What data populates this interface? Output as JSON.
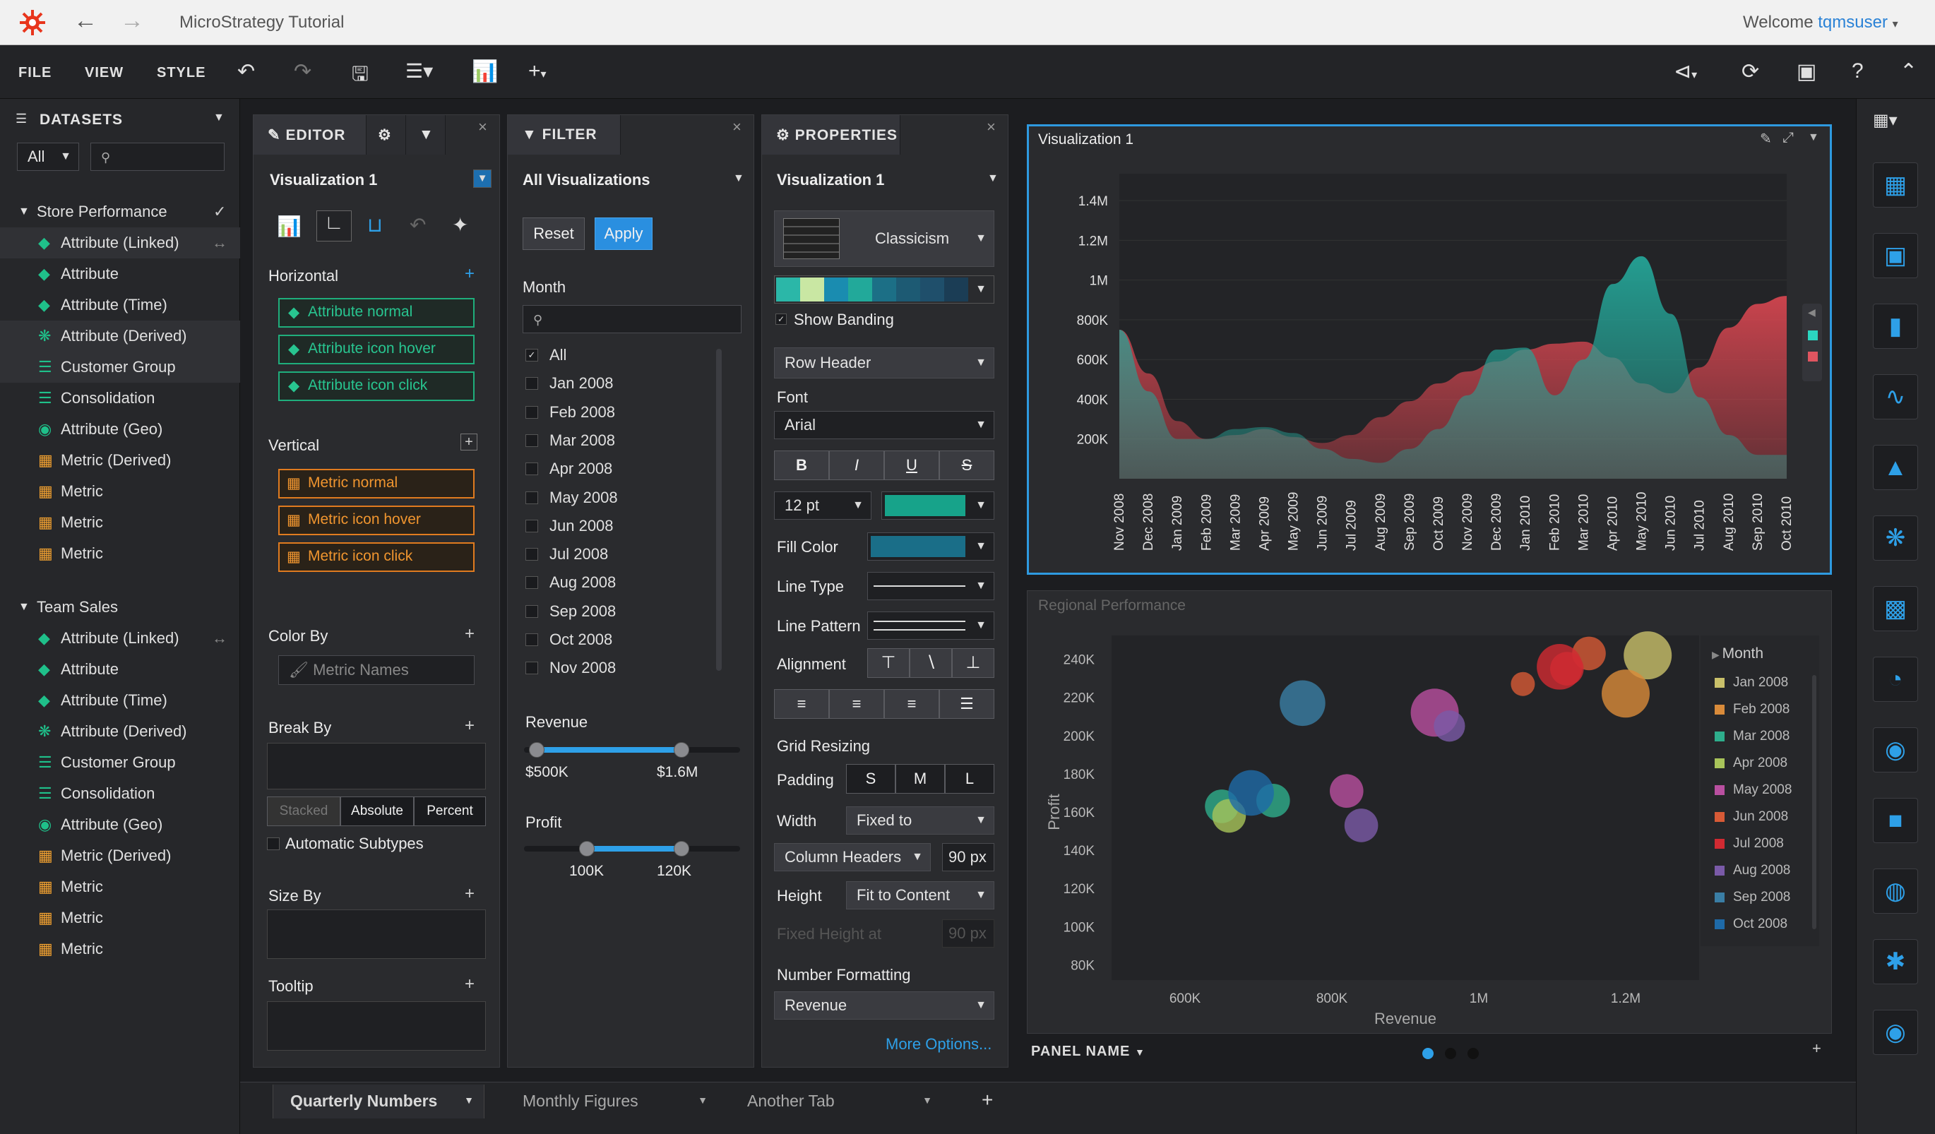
{
  "app": {
    "title": "MicroStrategy Tutorial",
    "welcome": "Welcome ",
    "user": "tqmsuser"
  },
  "menu": {
    "file": "FILE",
    "view": "VIEW",
    "style": "STYLE"
  },
  "datasets": {
    "title": "DATASETS",
    "filter": "All",
    "groups": [
      {
        "name": "Store Performance",
        "items": [
          "Attribute (Linked)",
          "Attribute",
          "Attribute (Time)",
          "Attribute (Derived)",
          "Customer Group",
          "Consolidation",
          "Attribute (Geo)",
          "Metric (Derived)",
          "Metric",
          "Metric",
          "Metric"
        ]
      },
      {
        "name": "Team Sales",
        "items": [
          "Attribute (Linked)",
          "Attribute",
          "Attribute (Time)",
          "Attribute (Derived)",
          "Customer Group",
          "Consolidation",
          "Attribute (Geo)",
          "Metric (Derived)",
          "Metric",
          "Metric",
          "Metric"
        ]
      }
    ]
  },
  "editor": {
    "tab": "EDITOR",
    "viz": "Visualization 1",
    "horizontal": "Horizontal",
    "h_items": [
      "Attribute normal",
      "Attribute icon hover",
      "Attribute icon click"
    ],
    "vertical": "Vertical",
    "v_items": [
      "Metric normal",
      "Metric icon hover",
      "Metric icon click"
    ],
    "color_by": "Color By",
    "color_placeholder": "Metric Names",
    "break_by": "Break By",
    "seg": [
      "Stacked",
      "Absolute",
      "Percent"
    ],
    "auto_subtypes": "Automatic Subtypes",
    "size_by": "Size By",
    "tooltip": "Tooltip"
  },
  "filter": {
    "tab": "FILTER",
    "scope": "All Visualizations",
    "reset": "Reset",
    "apply": "Apply",
    "month": "Month",
    "months": [
      "All",
      "Jan 2008",
      "Feb 2008",
      "Mar 2008",
      "Apr 2008",
      "May 2008",
      "Jun 2008",
      "Jul 2008",
      "Aug 2008",
      "Sep 2008",
      "Oct 2008",
      "Nov 2008"
    ],
    "revenue": "Revenue",
    "rev_min": "$500K",
    "rev_max": "$1.6M",
    "rev_range": [
      0.06,
      0.73
    ],
    "profit": "Profit",
    "prof_min": "100K",
    "prof_max": "120K",
    "prof_range": [
      0.29,
      0.73
    ]
  },
  "properties": {
    "tab": "PROPERTIES",
    "viz": "Visualization 1",
    "theme": "Classicism",
    "show_banding": "Show Banding",
    "row_header": "Row Header",
    "font_label": "Font",
    "font": "Arial",
    "bold": "B",
    "italic": "I",
    "underline": "U",
    "strike": "S",
    "size": "12 pt",
    "fill_color": "Fill Color",
    "line_type": "Line Type",
    "line_pattern": "Line Pattern",
    "alignment": "Alignment",
    "grid_resizing": "Grid Resizing",
    "padding": "Padding",
    "pad_opts": [
      "S",
      "M",
      "L"
    ],
    "width": "Width",
    "width_val": "Fixed to",
    "col_headers": "Column Headers",
    "width_px": "90 px",
    "height": "Height",
    "height_val": "Fit to Content",
    "fixed_height": "Fixed Height at",
    "fixed_px": "90 px",
    "number_formatting": "Number Formatting",
    "metric": "Revenue",
    "more": "More Options...",
    "palette": [
      "#2bb7a8",
      "#c9e7a3",
      "#1a8cb0",
      "#22a99a",
      "#1c6f86",
      "#1d5a73",
      "#1f4f6b",
      "#1b3d55"
    ],
    "swatch": "#17a38a",
    "fill": "#1a6e88"
  },
  "viz1": {
    "title": "Visualization 1",
    "chart_data": {
      "type": "area",
      "title": "Visualization 1",
      "categories": [
        "Nov 2008",
        "Dec 2008",
        "Jan 2009",
        "Feb 2009",
        "Mar 2009",
        "Apr 2009",
        "May 2009",
        "Jun 2009",
        "Jul 2009",
        "Aug 2009",
        "Sep 2009",
        "Oct 2009",
        "Nov 2009",
        "Dec 2009",
        "Jan 2010",
        "Feb 2010",
        "Mar 2010",
        "Apr 2010",
        "May 2010",
        "Jun 2010",
        "Jul 2010",
        "Aug 2010",
        "Sep 2010",
        "Oct 2010"
      ],
      "ylabels": [
        "200K",
        "400K",
        "600K",
        "800K",
        "1M",
        "1.2M",
        "1.4M"
      ],
      "ylim": [
        0,
        1500000
      ],
      "series": [
        {
          "color": "#d2454f",
          "values": [
            750000,
            530000,
            290000,
            200000,
            220000,
            250000,
            210000,
            180000,
            220000,
            310000,
            390000,
            480000,
            540000,
            590000,
            650000,
            680000,
            690000,
            610000,
            480000,
            430000,
            560000,
            760000,
            880000,
            920000
          ]
        },
        {
          "color": "#24a396",
          "values": [
            750000,
            440000,
            200000,
            200000,
            250000,
            260000,
            230000,
            150000,
            100000,
            80000,
            150000,
            250000,
            420000,
            650000,
            660000,
            420000,
            600000,
            980000,
            1120000,
            830000,
            410000,
            220000,
            120000,
            120000
          ]
        }
      ]
    }
  },
  "viz2": {
    "title": "Regional Performance",
    "chart_data": {
      "type": "scatter",
      "title": "Regional Performance",
      "xlabel": "Revenue",
      "ylabel": "Profit",
      "xticks": [
        "600K",
        "800K",
        "1M",
        "1.2M"
      ],
      "yticks": [
        "80K",
        "100K",
        "120K",
        "140K",
        "160K",
        "180K",
        "200K",
        "220K",
        "240K"
      ],
      "xlim": [
        500000,
        1300000
      ],
      "ylim": [
        75000,
        245000
      ],
      "legend_title": "Month",
      "series": [
        {
          "name": "Jan 2008",
          "color": "#c9c06a",
          "points": [
            [
              1230000,
              242000,
              20
            ]
          ]
        },
        {
          "name": "Feb 2008",
          "color": "#d98b3a",
          "points": [
            [
              1200000,
              222000,
              20
            ]
          ]
        },
        {
          "name": "Mar 2008",
          "color": "#2eae8c",
          "points": [
            [
              650000,
              163000,
              14
            ],
            [
              720000,
              166000,
              14
            ]
          ]
        },
        {
          "name": "Apr 2008",
          "color": "#a8c45a",
          "points": [
            [
              660000,
              158000,
              14
            ]
          ]
        },
        {
          "name": "May 2008",
          "color": "#b94fa0",
          "points": [
            [
              940000,
              212000,
              20
            ],
            [
              820000,
              171000,
              14
            ]
          ]
        },
        {
          "name": "Jun 2008",
          "color": "#d75a36",
          "points": [
            [
              1150000,
              243000,
              14
            ],
            [
              1060000,
              227000,
              10
            ]
          ]
        },
        {
          "name": "Jul 2008",
          "color": "#d12a32",
          "points": [
            [
              1110000,
              236000,
              19
            ],
            [
              1120000,
              235000,
              14
            ]
          ]
        },
        {
          "name": "Aug 2008",
          "color": "#7a5aa8",
          "points": [
            [
              840000,
              153000,
              14
            ],
            [
              960000,
              205000,
              13
            ]
          ]
        },
        {
          "name": "Sep 2008",
          "color": "#3a7ea5",
          "points": [
            [
              760000,
              217000,
              19
            ]
          ]
        },
        {
          "name": "Oct 2008",
          "color": "#1e6aa8",
          "points": [
            [
              690000,
              170000,
              19
            ]
          ]
        }
      ]
    }
  },
  "panel_name": "PANEL NAME",
  "tabs": [
    "Quarterly Numbers",
    "Monthly Figures",
    "Another Tab"
  ]
}
